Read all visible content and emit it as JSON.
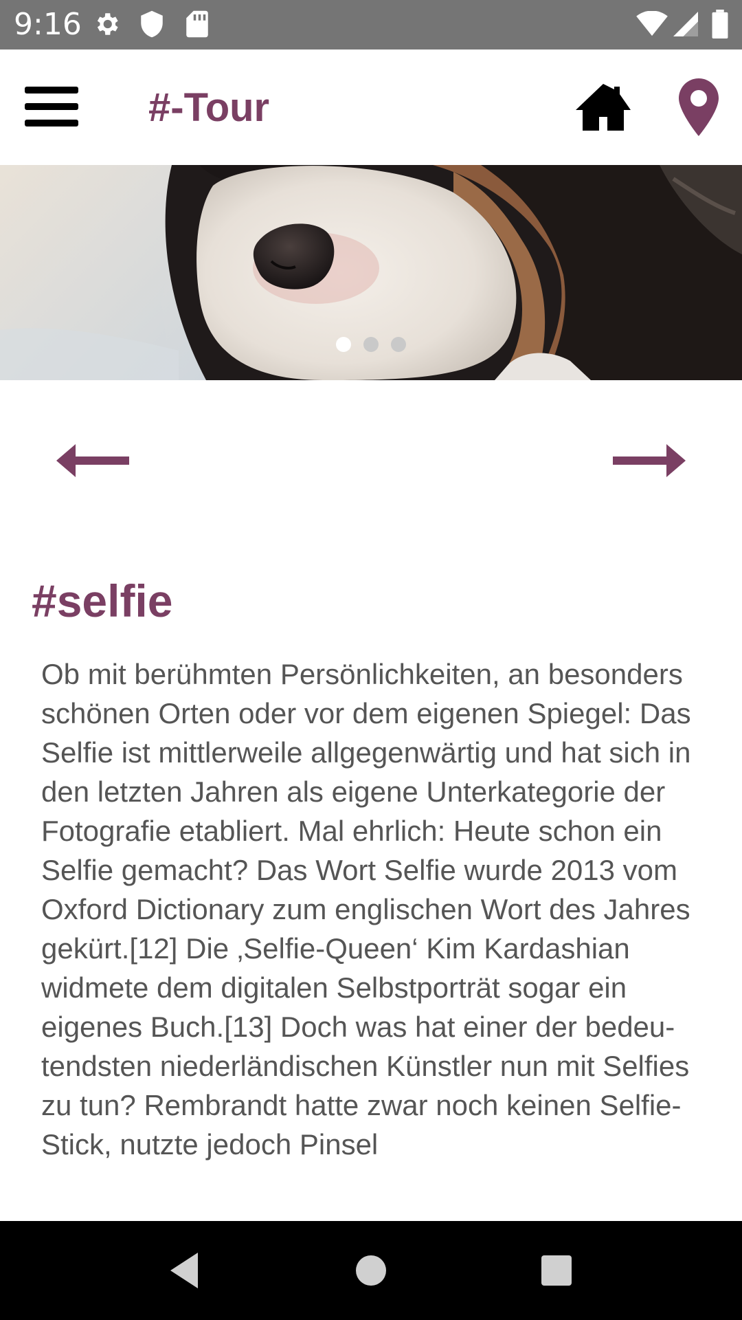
{
  "status_bar": {
    "time": "9:16",
    "left_icons": [
      "gear-icon",
      "shield-icon",
      "sd-card-icon"
    ],
    "right_icons": [
      "wifi-icon",
      "signal-icon",
      "battery-icon"
    ]
  },
  "app_bar": {
    "title": "#-Tour",
    "menu_icon": "hamburger-menu-icon",
    "home_icon": "home-icon",
    "location_icon": "map-pin-icon",
    "accent_color": "#7a3f63"
  },
  "carousel": {
    "image": "puppy-photo",
    "page_count": 3,
    "active_index": 0
  },
  "navigation": {
    "prev_icon": "arrow-left-icon",
    "next_icon": "arrow-right-icon"
  },
  "content": {
    "title": "#selfie",
    "body": "Ob mit berühmten Persönlichkeiten, an besonders schönen Orten oder vor dem eigenen Spiegel: Das Selfie ist mittlerweile allgegenwärtig und hat sich in den letzten Jahren als eigene Unterkategorie der Fotografie etabliert. Mal ehrlich: Heute schon ein Selfie gemacht? Das Wort Selfie wurde 2013 vom Oxford Dictionary zum englischen Wort des Jahres gekürt.[12] Die ‚Selfie-Queen‘ Kim Kardashian widmete dem digitalen Selbstporträt sogar ein eigenes Buch.[13] Doch was hat einer der bedeu-tendsten niederländischen Künstler nun mit Selfies zu tun? Rembrandt hatte zwar noch keinen Selfie-Stick, nutzte jedoch Pinsel"
  },
  "system_nav": {
    "back_icon": "back-triangle-icon",
    "home_icon": "home-circle-icon",
    "recents_icon": "recents-square-icon"
  }
}
